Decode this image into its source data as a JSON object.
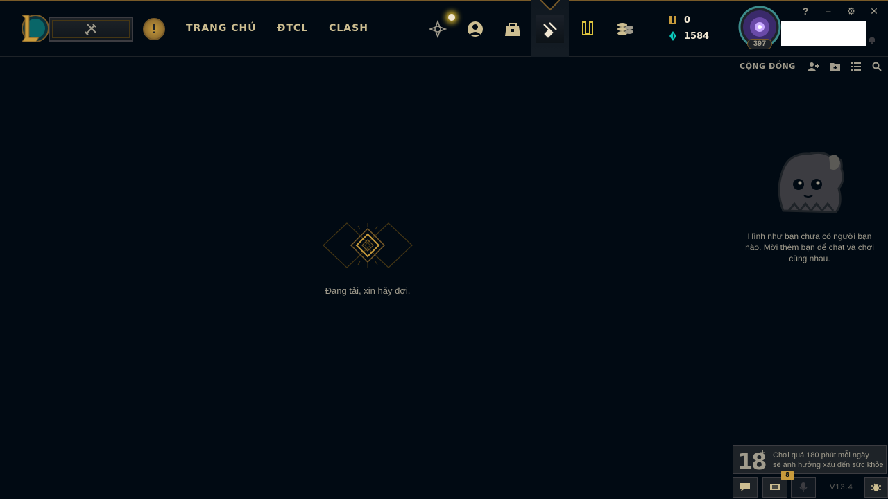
{
  "header": {
    "nav": [
      "TRANG CHỦ",
      "ĐTCL",
      "CLASH"
    ],
    "currency": {
      "rp": "0",
      "blue_essence": "1584"
    },
    "profile": {
      "level": "397"
    },
    "window_controls": {
      "help": "?",
      "minimize": "–",
      "settings": "⚙",
      "close": "✕"
    }
  },
  "social": {
    "title": "CỘNG ĐỒNG",
    "empty_message": "Hình như bạn chưa có người bạn nào. Mời thêm bạn để chat và chơi cùng nhau."
  },
  "main": {
    "loading_text": "Đang tải, xin hãy đợi."
  },
  "footer": {
    "age_rating": "18",
    "age_plus": "+",
    "warning_line1": "Chơi quá 180 phút mỗi ngày",
    "warning_line2": "sẽ ảnh hưởng xấu đến sức khỏe",
    "mission_count": "8",
    "version": "V13.4"
  },
  "colors": {
    "background": "#010a13",
    "gold": "#c89b3c",
    "gold_light": "#cdbe91",
    "text": "#a09b8c",
    "blue_essence": "#0ac8b9"
  },
  "icons": [
    "league-logo-icon",
    "crossed-swords-icon",
    "alert-icon",
    "ranked-crest-icon",
    "profile-icon",
    "collection-icon",
    "loot-icon",
    "tft-pass-icon",
    "store-icon",
    "rp-icon",
    "blue-essence-icon",
    "bell-icon",
    "add-friend-icon",
    "add-folder-icon",
    "list-icon",
    "search-icon",
    "poro-icon",
    "chat-icon",
    "missions-icon",
    "mic-icon",
    "bug-report-icon"
  ]
}
